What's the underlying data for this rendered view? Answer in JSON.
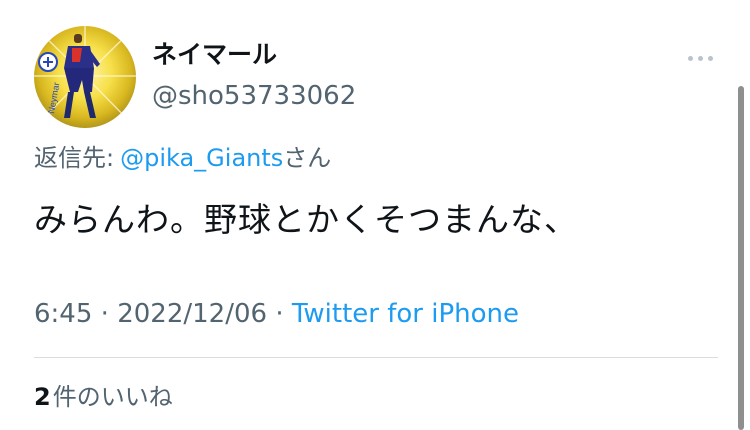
{
  "user": {
    "display_name": "ネイマール",
    "handle": "@sho53733062"
  },
  "reply": {
    "prefix": "返信先:",
    "mention": "@pika_Giants",
    "suffix": "さん"
  },
  "tweet": {
    "text": "みらんわ。野球とかくそつまんな、"
  },
  "meta": {
    "time": "6:45",
    "separator": "·",
    "date": "2022/12/06",
    "source": "Twitter for iPhone"
  },
  "likes": {
    "count": "2",
    "label": "件のいいね"
  },
  "icons": {
    "more": "more-horizontal-icon"
  },
  "colors": {
    "link": "#1d9bf0",
    "secondary_text": "#536471",
    "primary_text": "#0f1419",
    "divider": "#d8dde1"
  }
}
